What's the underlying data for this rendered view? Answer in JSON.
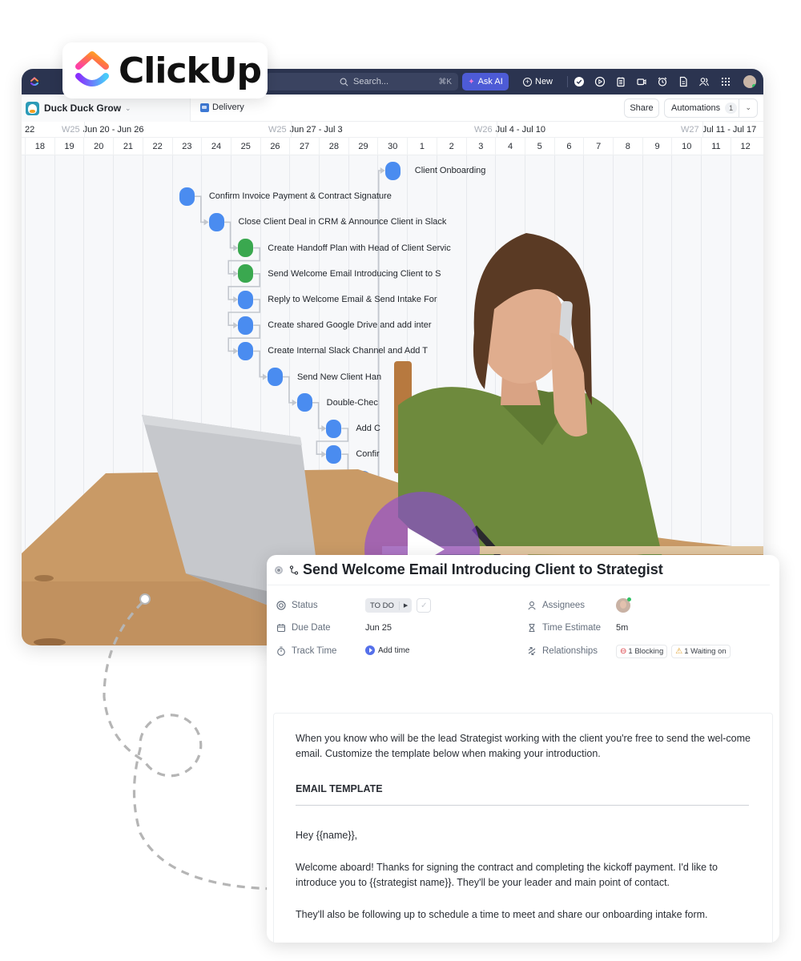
{
  "brand": {
    "logo_text": "ClickUp",
    "gradient": [
      "#fd71af",
      "#ff9f1a",
      "#8930fd",
      "#49ccf9"
    ]
  },
  "topbar": {
    "search_placeholder": "Search...",
    "search_shortcut": "⌘K",
    "ask_ai_label": "Ask AI",
    "new_label": "New",
    "icons": [
      "check-circle-icon",
      "record-icon",
      "notepad-icon",
      "video-icon",
      "alarm-icon",
      "document-icon",
      "people-icon",
      "apps-grid-icon"
    ],
    "bg_color": "#2b3450",
    "ai_color": "#4d5bd6"
  },
  "subheader": {
    "workspace_name": "Duck Duck Grow",
    "list_name": "Delivery",
    "share_label": "Share",
    "automations_label": "Automations",
    "automations_count": "1"
  },
  "timeline": {
    "weeks": [
      {
        "num": "",
        "range": "22"
      },
      {
        "num": "W25",
        "range": "Jun 20 - Jun 26"
      },
      {
        "num": "W25",
        "range": "Jun 27 - Jul 3"
      },
      {
        "num": "W26",
        "range": "Jul 4 - Jul 10"
      },
      {
        "num": "W27",
        "range": "Jul 11 - Jul 17"
      }
    ],
    "days": [
      "18",
      "19",
      "20",
      "21",
      "22",
      "23",
      "24",
      "25",
      "26",
      "27",
      "28",
      "29",
      "30",
      "1",
      "2",
      "3",
      "4",
      "5",
      "6",
      "7",
      "8",
      "9",
      "10",
      "11",
      "12"
    ],
    "tasks": [
      {
        "label": "Client Onboarding",
        "color": "blue",
        "day_index": 12.5,
        "row": 0
      },
      {
        "label": "Confirm Invoice Payment & Contract Signature",
        "color": "blue",
        "day_index": 5.5,
        "row": 1
      },
      {
        "label": "Close Client Deal in CRM & Announce Client in Slack",
        "color": "blue",
        "day_index": 6.5,
        "row": 2
      },
      {
        "label": "Create Handoff Plan with Head of Client Servic",
        "color": "green",
        "day_index": 7.5,
        "row": 3
      },
      {
        "label": "Send Welcome Email Introducing Client to S",
        "color": "green",
        "day_index": 7.5,
        "row": 4
      },
      {
        "label": "Reply to Welcome Email & Send Intake For",
        "color": "blue",
        "day_index": 7.5,
        "row": 5
      },
      {
        "label": "Create shared Google Drive and add inter",
        "color": "blue",
        "day_index": 7.5,
        "row": 6
      },
      {
        "label": "Create Internal Slack Channel and Add T",
        "color": "blue",
        "day_index": 7.5,
        "row": 7
      },
      {
        "label": "Send New Client Han",
        "color": "blue",
        "day_index": 8.5,
        "row": 8
      },
      {
        "label": "Double-Chec",
        "color": "blue",
        "day_index": 9.5,
        "row": 9
      },
      {
        "label": "Add C",
        "color": "blue",
        "day_index": 10.5,
        "row": 10
      },
      {
        "label": "Confir",
        "color": "blue",
        "day_index": 10.5,
        "row": 11
      },
      {
        "label": "",
        "color": "blue",
        "day_index": 11.5,
        "row": 12
      },
      {
        "label": "",
        "color": "blue",
        "day_index": 11.5,
        "row": 13
      },
      {
        "label": "",
        "color": "blue",
        "day_index": 11.5,
        "row": 14
      }
    ],
    "task_colors": {
      "blue": "#4a8cf0",
      "green": "#3aa84f"
    }
  },
  "video": {
    "play_label": "Play video",
    "overlay_color": "#8c46dc"
  },
  "task_detail": {
    "title": "Send Welcome Email Introducing Client to Strategist",
    "fields_left": [
      {
        "label": "Status",
        "icon": "status-icon"
      },
      {
        "label": "Due Date",
        "icon": "calendar-icon"
      },
      {
        "label": "Track Time",
        "icon": "stopwatch-icon"
      }
    ],
    "status_value": "TO DO",
    "due_date_value": "Jun 25",
    "track_time_value": "Add time",
    "fields_right": [
      {
        "label": "Assignees",
        "icon": "user-icon"
      },
      {
        "label": "Time Estimate",
        "icon": "hourglass-icon"
      },
      {
        "label": "Relationships",
        "icon": "relationship-icon"
      }
    ],
    "time_estimate_value": "5m",
    "blocking_label": "1 Blocking",
    "waiting_label": "1 Waiting on",
    "description": {
      "intro": "When you know who will be the lead Strategist working with the client you're free to send the wel-come email. Customize the template below when making your introduction.",
      "heading": "EMAIL TEMPLATE",
      "paragraphs": [
        "Hey {{name}},",
        "Welcome aboard! Thanks for signing the contract and completing the kickoff payment. I'd like to introduce you to {{strategist name}}. They'll be your leader and main point of contact.",
        "They'll also be following up to schedule a time to meet and share our onboarding intake form."
      ]
    }
  }
}
